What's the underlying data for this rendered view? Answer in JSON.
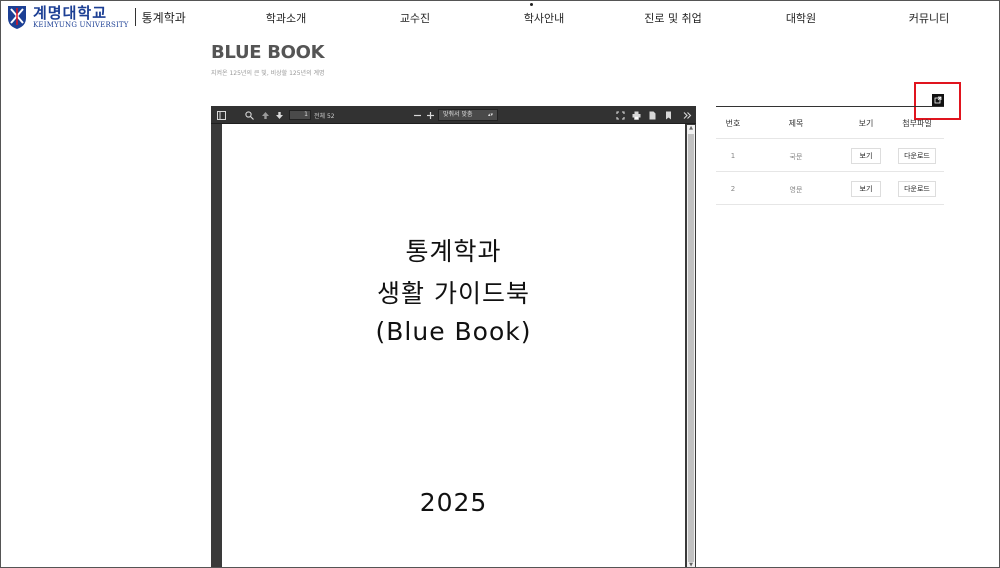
{
  "brand": {
    "name_ko": "계명대학교",
    "name_en": "KEIMYUNG UNIVERSITY",
    "department": "통계학과",
    "accent": "#1c3f94"
  },
  "nav": {
    "items": [
      "학과소개",
      "교수진",
      "학사안내",
      "진로 및 취업",
      "대학원",
      "커뮤니티"
    ]
  },
  "page": {
    "title": "BLUE BOOK",
    "subtitle": "지켜온 125년의 큰 빛, 비상할 125년의 계명"
  },
  "viewer": {
    "page_number": "1",
    "page_total": "전체 52",
    "zoom_label": "맞춰서 맞춤",
    "icons": [
      "sidebar-toggle-icon",
      "search-icon",
      "arrow-up-icon",
      "arrow-down-icon",
      "zoom-out-icon",
      "zoom-in-icon",
      "fullscreen-icon",
      "print-icon",
      "download-icon",
      "bookmark-icon",
      "more-tools-icon"
    ],
    "document_lines": [
      "통계학과",
      "생활 가이드북",
      "(Blue Book)",
      "2025"
    ]
  },
  "table": {
    "headers": [
      "번호",
      "제목",
      "보기",
      "첨부파일"
    ],
    "rows": [
      {
        "no": "1",
        "title": "국문",
        "view": "보기",
        "download": "다운로드"
      },
      {
        "no": "2",
        "title": "영문",
        "view": "보기",
        "download": "다운로드"
      }
    ]
  },
  "colors": {
    "highlight": "#e0141e",
    "viewer_bg": "#3a3a3a",
    "toolbar_bg": "#323232"
  }
}
